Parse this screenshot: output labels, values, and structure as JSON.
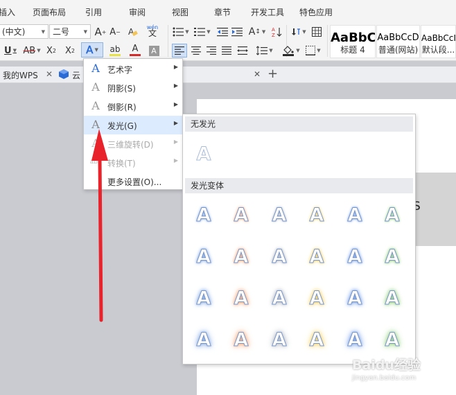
{
  "menubar": {
    "tabs": [
      "插入",
      "页面布局",
      "引用",
      "审阅",
      "视图",
      "章节",
      "开发工具",
      "特色应用"
    ]
  },
  "ribbon": {
    "font_name": "(中文)",
    "font_size": "二号",
    "grow_font": "A",
    "shrink_font": "A",
    "pinyin": "wén",
    "pinyin_char": "文",
    "underline": "U",
    "strikethrough": "AB",
    "superscript": "X",
    "subscript": "X",
    "text_effect": "A",
    "highlight": "ab",
    "font_color": "A",
    "char_shading": "A",
    "char_spacing_letter": "A",
    "styles": [
      {
        "sample": "AaBbC",
        "name": "标题 4"
      },
      {
        "sample": "AaBbCcD",
        "name": "普通(网站)"
      },
      {
        "sample": "AaBbCcI",
        "name": "默认段..."
      }
    ]
  },
  "tabbar": {
    "tabs": [
      "我的WPS",
      "云",
      "* "
    ]
  },
  "document": {
    "block_glyph": "S"
  },
  "popup": {
    "items": [
      {
        "icon": "A",
        "label": "艺术字",
        "has_submenu": true,
        "state": "normal"
      },
      {
        "icon": "A",
        "label": "阴影(S)",
        "has_submenu": true,
        "state": "normal"
      },
      {
        "icon": "A",
        "label": "倒影(R)",
        "has_submenu": true,
        "state": "normal"
      },
      {
        "icon": "A",
        "label": "发光(G)",
        "has_submenu": true,
        "state": "hover"
      },
      {
        "icon": "A",
        "label": "三维旋转(D)",
        "has_submenu": true,
        "state": "disabled"
      },
      {
        "icon": "abc",
        "label": "转换(T)",
        "has_submenu": true,
        "state": "disabled"
      },
      {
        "icon": "",
        "label": "更多设置(O)...",
        "has_submenu": false,
        "state": "normal"
      }
    ]
  },
  "submenu": {
    "no_glow_header": "无发光",
    "variants_header": "发光变体",
    "sample_letter": "A",
    "glow_colors": [
      "#7fa6e0",
      "#f2a472",
      "#aeb4be",
      "#f4d05f",
      "#6f9be5",
      "#8fcf78"
    ]
  },
  "watermark": {
    "brand": "Baidu经验",
    "url": "jingyan.baidu.com"
  },
  "colors": {
    "highlight_bar": "#e8e24a",
    "font_color_bar": "#d42a2a",
    "arrow": "#e8232b",
    "accent": "#2a6ad6"
  }
}
